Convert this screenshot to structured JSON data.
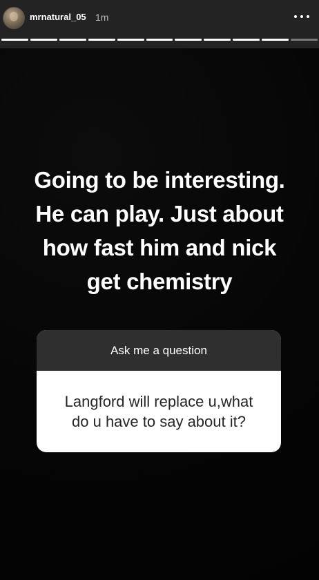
{
  "header": {
    "username": "mrnatural_05",
    "time": "1m",
    "more_icon": "more-horizontal-icon"
  },
  "progress": {
    "segments_total": 11,
    "segments_done": 10,
    "segment_color_done": "#ffffff",
    "segment_color_pending": "#7a7a7a"
  },
  "story": {
    "caption_lines": [
      "Going to be interesting.",
      "He can play. Just about",
      "how fast him and nick",
      "get chemistry"
    ]
  },
  "question_sticker": {
    "title": "Ask me a question",
    "answer_lines": [
      "Langford will replace u,what",
      "do u have to say about it?"
    ]
  }
}
